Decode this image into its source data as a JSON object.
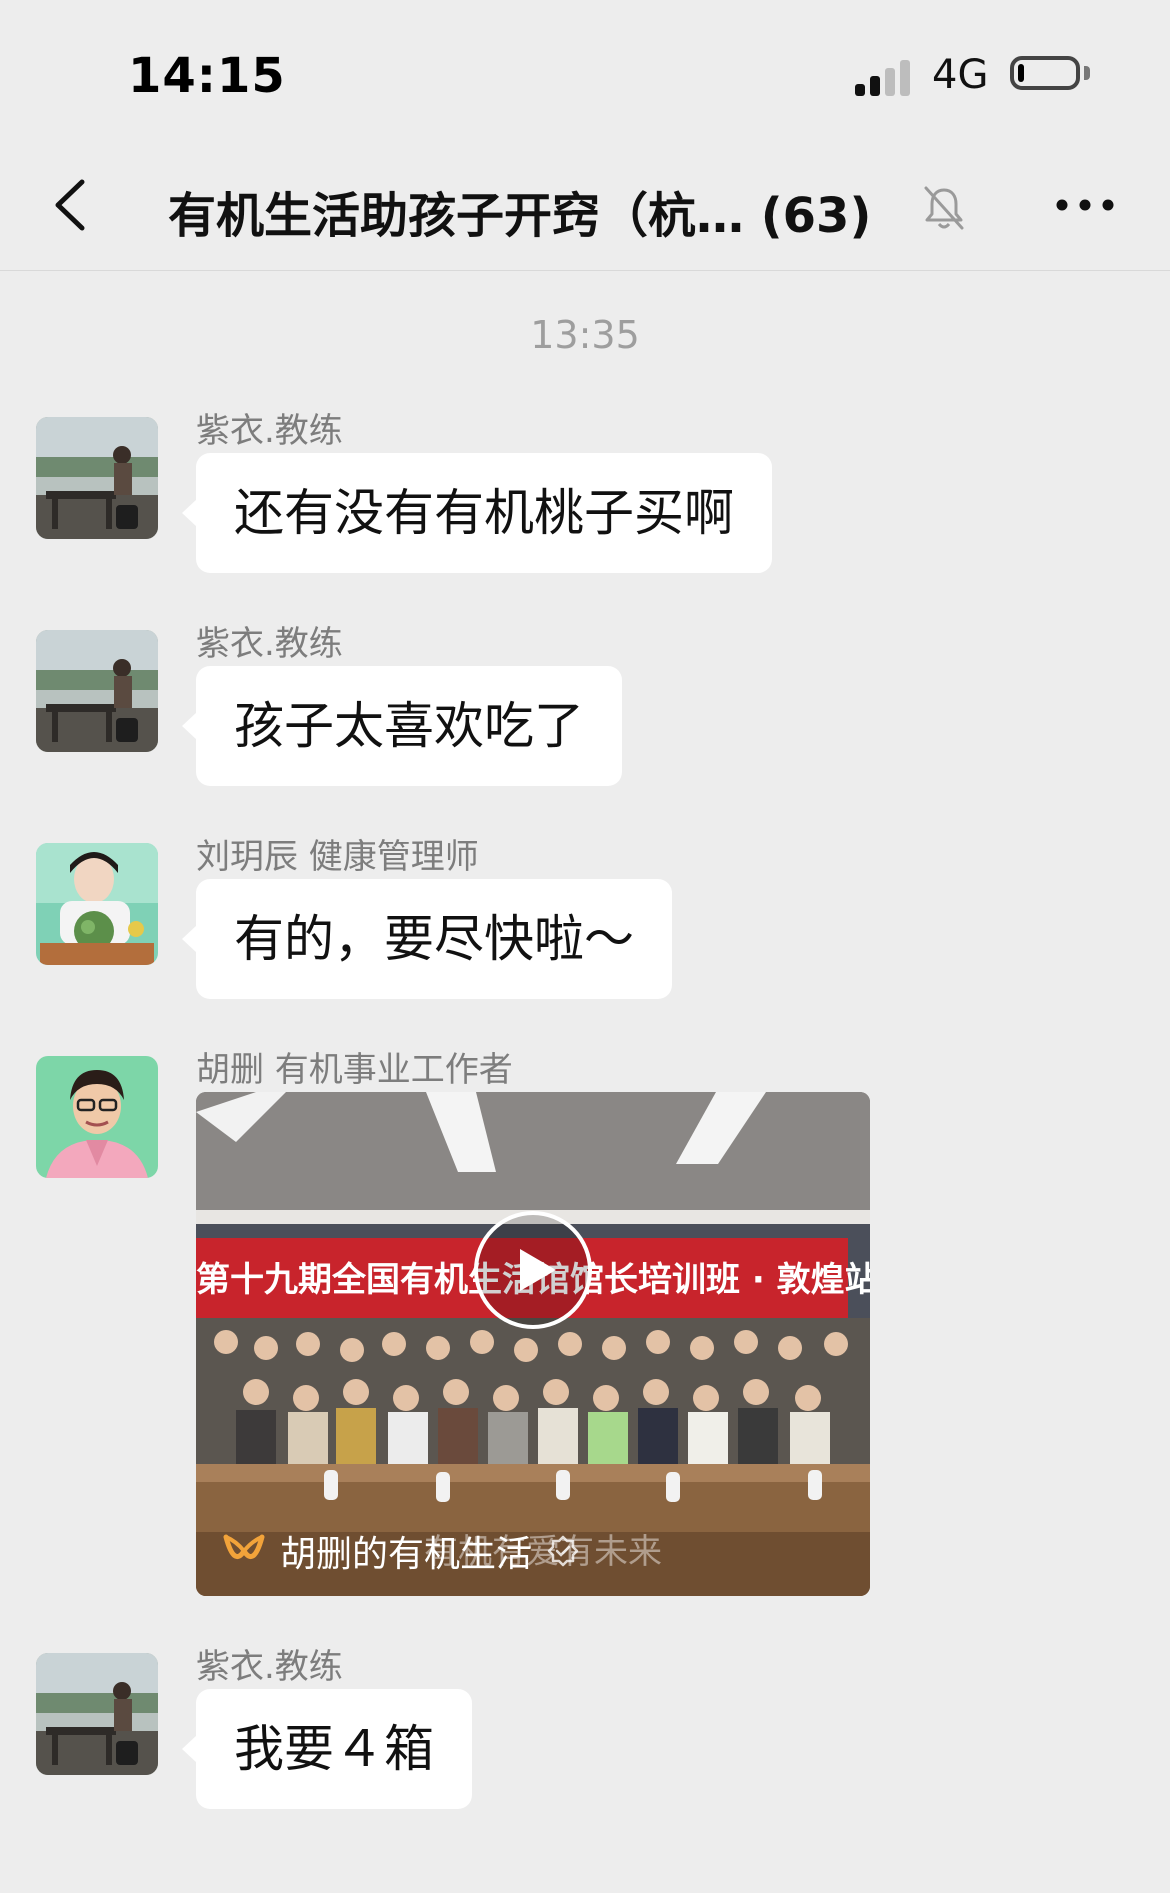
{
  "status_bar": {
    "time": "14:15",
    "network": "4G",
    "battery_level": 0.12
  },
  "nav": {
    "title": "有机生活助孩子开窍（杭…  (63)",
    "icons": [
      "back-chevron-icon",
      "mute-bell-icon",
      "more-dots-icon"
    ]
  },
  "chat": {
    "time_separator": "13:35",
    "messages": [
      {
        "sender": "紫衣.教练",
        "text": "还有没有有机桃子买啊"
      },
      {
        "sender": "紫衣.教练",
        "text": "孩子太喜欢吃了"
      },
      {
        "sender": "刘玥辰 健康管理师",
        "text": "有的，要尽快啦～"
      },
      {
        "sender": "胡删 有机事业工作者",
        "video": {
          "banner": "第十九期全国有机生活馆馆长培训班 · 敦煌站",
          "channel": "胡删的有机生活",
          "watermark": "有机有爱有未来"
        }
      },
      {
        "sender": "紫衣.教练",
        "text": "我要４箱"
      }
    ]
  },
  "colors": {
    "background": "#ededed",
    "bubble": "#ffffff",
    "sender_text": "#7d7d7d",
    "banner_red": "#c8242c",
    "channel_icon_orange": "#f2a33a"
  }
}
